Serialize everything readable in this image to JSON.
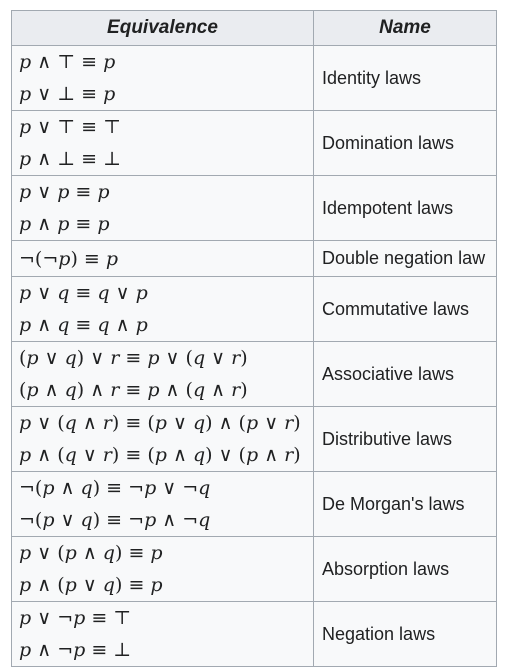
{
  "table": {
    "headers": {
      "equivalence": "Equivalence",
      "name": "Name"
    },
    "rows": [
      {
        "lines": [
          "p ∧ ⊤ ≡ p",
          "p ∨ ⊥ ≡ p"
        ],
        "name": "Identity laws"
      },
      {
        "lines": [
          "p ∨ ⊤ ≡ ⊤",
          "p ∧ ⊥ ≡ ⊥"
        ],
        "name": "Domination laws"
      },
      {
        "lines": [
          "p ∨ p ≡ p",
          "p ∧ p ≡ p"
        ],
        "name": "Idempotent laws"
      },
      {
        "lines": [
          "¬(¬p) ≡ p"
        ],
        "name": "Double negation law"
      },
      {
        "lines": [
          "p ∨ q ≡ q ∨ p",
          "p ∧ q ≡ q ∧ p"
        ],
        "name": "Commutative laws"
      },
      {
        "lines": [
          "(p ∨ q) ∨ r ≡ p ∨ (q ∨ r)",
          "(p ∧ q) ∧ r ≡ p ∧ (q ∧ r)"
        ],
        "name": "Associative laws"
      },
      {
        "lines": [
          "p ∨ (q ∧ r) ≡ (p ∨ q) ∧ (p ∨ r)",
          "p ∧ (q ∨ r) ≡ (p ∧ q) ∨ (p ∧ r)"
        ],
        "name": "Distributive laws"
      },
      {
        "lines": [
          "¬(p ∧ q) ≡ ¬p ∨ ¬q",
          "¬(p ∨ q) ≡ ¬p ∧ ¬q"
        ],
        "name": "De Morgan's laws"
      },
      {
        "lines": [
          "p ∨ (p ∧ q) ≡ p",
          "p ∧ (p ∨ q) ≡ p"
        ],
        "name": "Absorption laws"
      },
      {
        "lines": [
          "p ∨ ¬p ≡ ⊤",
          "p ∧ ¬p ≡ ⊥"
        ],
        "name": "Negation laws"
      }
    ]
  }
}
